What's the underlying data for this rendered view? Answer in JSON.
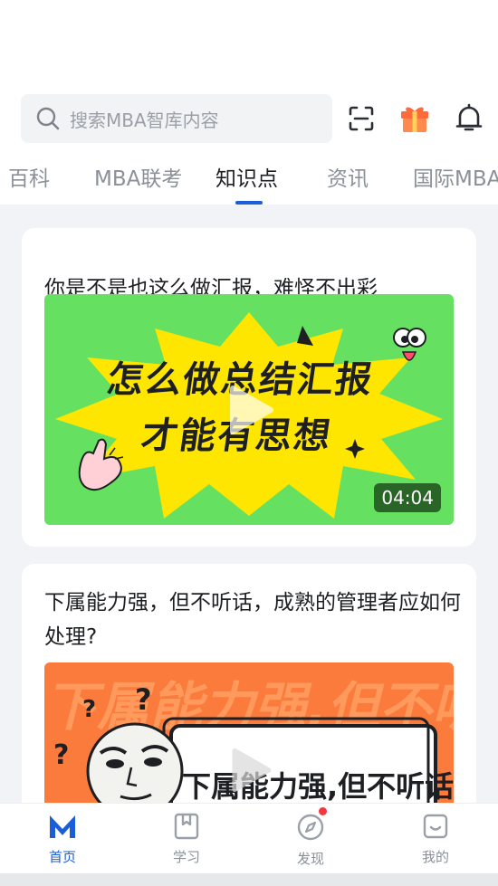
{
  "search": {
    "placeholder": "搜索MBA智库内容"
  },
  "tabs": [
    {
      "label": "百科"
    },
    {
      "label": "MBA联考"
    },
    {
      "label": "知识点"
    },
    {
      "label": "资讯"
    },
    {
      "label": "国际MBA"
    }
  ],
  "cards": [
    {
      "title": "你是不是也这么做汇报，难怪不出彩",
      "thumb_line1": "怎么做总结汇报",
      "thumb_line2": "才能有思想",
      "duration": "04:04"
    },
    {
      "title": "下属能力强，但不听话，成熟的管理者应如何处理?",
      "thumb_caption": "下属能力强,但不听话",
      "thumb_bg_text": "下属能力强,但不听话,"
    }
  ],
  "nav": [
    {
      "label": "首页"
    },
    {
      "label": "学习"
    },
    {
      "label": "发现"
    },
    {
      "label": "我的"
    }
  ],
  "colors": {
    "accent": "#1a5fd8",
    "badge": "#f0383e",
    "thumb1_bg": "#66e060",
    "thumb2_bg": "#fb7b3c"
  }
}
